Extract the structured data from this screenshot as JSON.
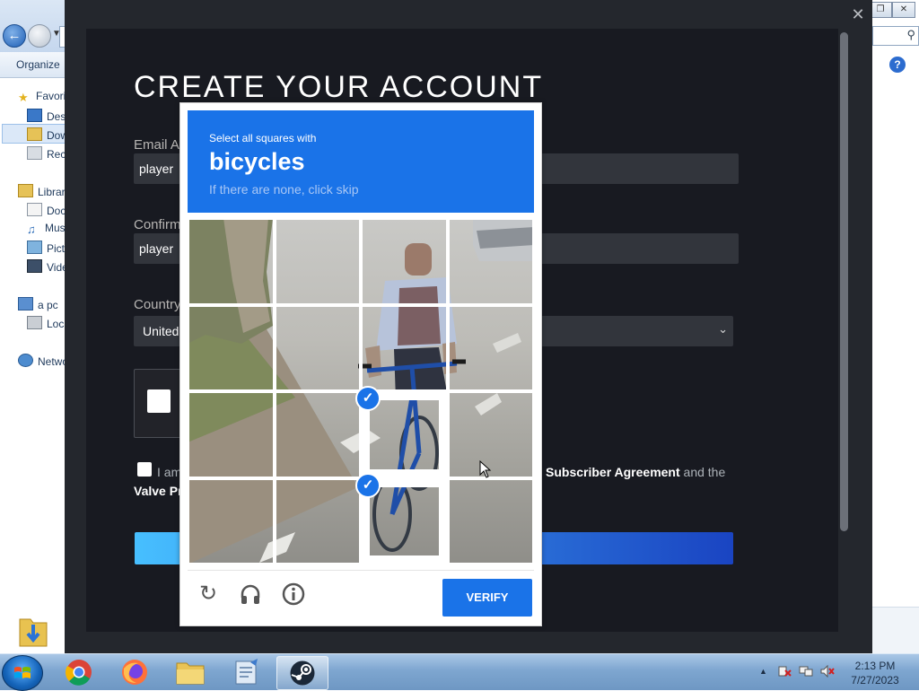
{
  "explorer": {
    "toolbar": {
      "organize": "Organize"
    },
    "sidebar": [
      {
        "label": "Favori",
        "icon": "star-icon"
      },
      {
        "label": "Desk",
        "icon": "desktop-icon"
      },
      {
        "label": "Dow",
        "icon": "downloads-icon"
      },
      {
        "label": "Rece",
        "icon": "recent-icon"
      },
      {
        "label": "Librar",
        "icon": "libraries-icon"
      },
      {
        "label": "Doc",
        "icon": "documents-icon"
      },
      {
        "label": "Mus",
        "icon": "music-icon"
      },
      {
        "label": "Pict",
        "icon": "pictures-icon"
      },
      {
        "label": "Vide",
        "icon": "videos-icon"
      },
      {
        "label": "a pc",
        "icon": "computer-icon"
      },
      {
        "label": "Loca",
        "icon": "disk-icon"
      },
      {
        "label": "Netwo",
        "icon": "network-icon"
      }
    ]
  },
  "steam": {
    "title": "CREATE YOUR ACCOUNT",
    "email_label": "Email Ac",
    "email_value": "player",
    "confirm_label": "Confirm",
    "confirm_value": "player",
    "country_label": "Country",
    "country_value": "United",
    "agree_prefix": "I am",
    "agree_link1": "Subscriber Agreement",
    "agree_and": "and the",
    "agree_link2": "Valve Pr"
  },
  "captcha": {
    "instruction": "Select all squares with",
    "target": "bicycles",
    "hint": "If there are none, click skip",
    "verify_label": "VERIFY",
    "selected_tiles": [
      10,
      14
    ],
    "grid_size": 4
  },
  "taskbar": {
    "apps": [
      "chrome",
      "firefox",
      "file-explorer",
      "notepad",
      "steam"
    ],
    "active_app": "steam",
    "time": "2:13 PM",
    "date": "7/27/2023"
  },
  "colors": {
    "captcha_blue": "#1a73e8",
    "steam_bg": "#181a21",
    "steam_input": "#32353c"
  }
}
